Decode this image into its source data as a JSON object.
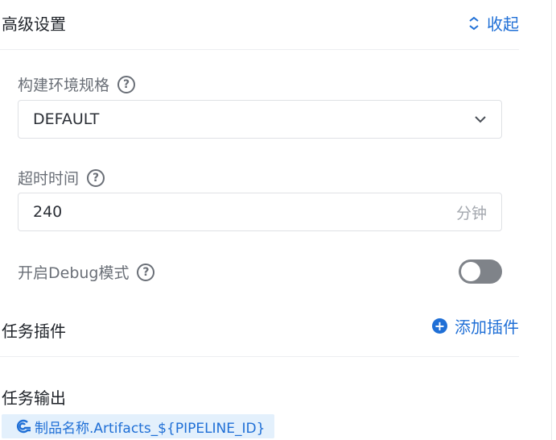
{
  "advanced": {
    "title": "高级设置",
    "collapse_label": "收起",
    "build_env": {
      "label": "构建环境规格",
      "value": "DEFAULT"
    },
    "timeout": {
      "label": "超时时间",
      "value": "240",
      "unit": "分钟"
    },
    "debug": {
      "label": "开启Debug模式",
      "enabled": false
    }
  },
  "plugins": {
    "title": "任务插件",
    "add_label": "添加插件"
  },
  "outputs": {
    "title": "任务输出",
    "artifact_name": "制品名称.Artifacts_${PIPELINE_ID}"
  },
  "colors": {
    "accent": "#1f6fd6",
    "toggle_off": "#7f8389",
    "tag_bg": "#e3f0fc"
  },
  "icons": [
    "chevrons-up-icon",
    "help-icon",
    "chevron-down-icon",
    "plus-circle-icon",
    "artifact-icon"
  ]
}
